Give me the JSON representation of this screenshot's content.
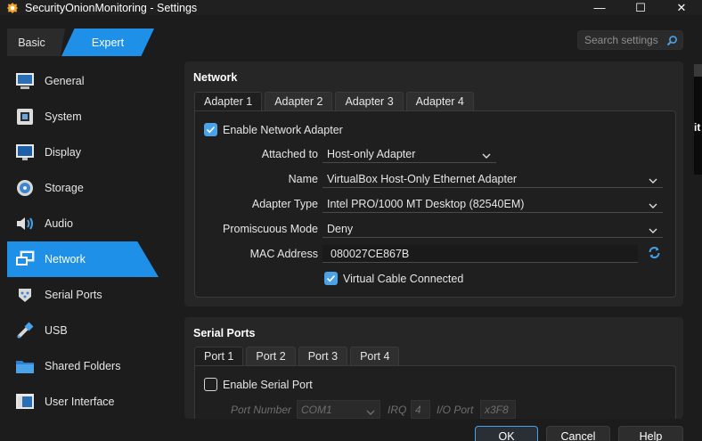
{
  "window": {
    "title": "SecurityOnionMonitoring - Settings",
    "controls": {
      "minimize": "—",
      "maximize": "☐",
      "close": "✕"
    }
  },
  "mode_tabs": {
    "basic": "Basic",
    "expert": "Expert",
    "selected": "Expert"
  },
  "search": {
    "placeholder": "Search settings"
  },
  "sidebar": {
    "selected": "Network",
    "items": [
      {
        "label": "General",
        "icon": "general-icon"
      },
      {
        "label": "System",
        "icon": "system-icon"
      },
      {
        "label": "Display",
        "icon": "display-icon"
      },
      {
        "label": "Storage",
        "icon": "storage-icon"
      },
      {
        "label": "Audio",
        "icon": "audio-icon"
      },
      {
        "label": "Network",
        "icon": "network-icon"
      },
      {
        "label": "Serial Ports",
        "icon": "serial-ports-icon"
      },
      {
        "label": "USB",
        "icon": "usb-icon"
      },
      {
        "label": "Shared Folders",
        "icon": "shared-folders-icon"
      },
      {
        "label": "User Interface",
        "icon": "user-interface-icon"
      }
    ]
  },
  "network": {
    "title": "Network",
    "tabs": [
      "Adapter 1",
      "Adapter 2",
      "Adapter 3",
      "Adapter 4"
    ],
    "active_tab": "Adapter 1",
    "enable_label": "Enable Network Adapter",
    "enabled": true,
    "attached_to": {
      "label": "Attached to",
      "value": "Host-only Adapter"
    },
    "name": {
      "label": "Name",
      "value": "VirtualBox Host-Only Ethernet Adapter"
    },
    "adapter_type": {
      "label": "Adapter Type",
      "value": "Intel PRO/1000 MT Desktop (82540EM)"
    },
    "promiscuous_mode": {
      "label": "Promiscuous Mode",
      "value": "Deny"
    },
    "mac_address": {
      "label": "MAC Address",
      "value": "080027CE867B"
    },
    "cable_connected": {
      "label": "Virtual Cable Connected",
      "checked": true
    }
  },
  "serial_ports": {
    "title": "Serial Ports",
    "tabs": [
      "Port 1",
      "Port 2",
      "Port 3",
      "Port 4"
    ],
    "active_tab": "Port 1",
    "enable_label": "Enable Serial Port",
    "enabled": false,
    "port_number": {
      "label": "Port Number",
      "value": "COM1"
    },
    "irq": {
      "label": "IRQ",
      "value": "4"
    },
    "io_port": {
      "label": "I/O Port",
      "value": "x3F8"
    }
  },
  "buttons": {
    "ok": "OK",
    "cancel": "Cancel",
    "help": "Help"
  },
  "background_window": {
    "text": "it"
  },
  "colors": {
    "accent": "#1e90e8",
    "checkbox": "#4aa3e8",
    "background": "#1c1c1c",
    "panel": "#262626"
  }
}
